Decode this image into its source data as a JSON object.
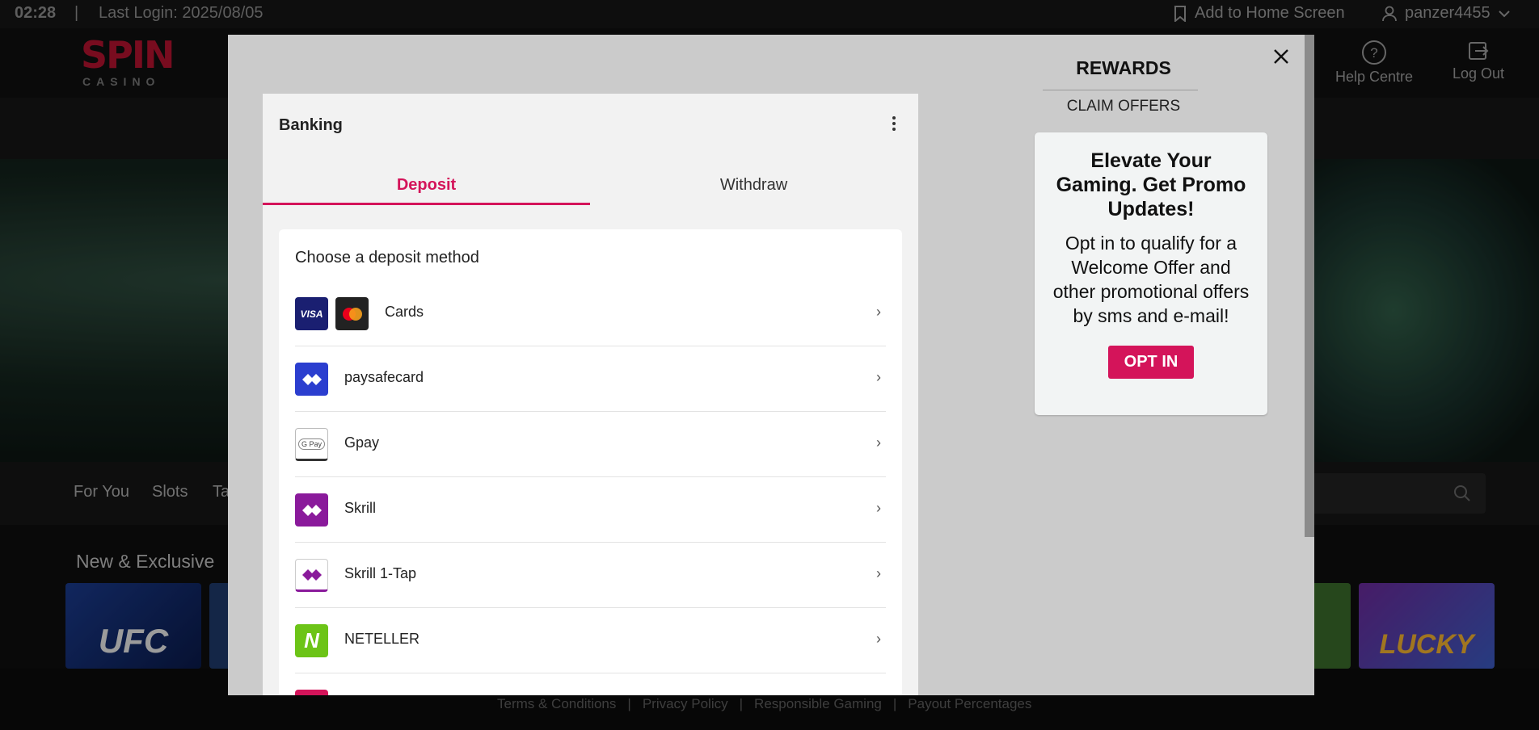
{
  "topbar": {
    "time": "02:28",
    "separator": "|",
    "last_login": "Last Login: 2025/08/05",
    "add_home": "Add to Home Screen",
    "username": "panzer4455"
  },
  "header": {
    "logo_spin": "SPIN",
    "logo_casino": "CASINO",
    "help": "Help Centre",
    "logout": "Log Out"
  },
  "categories": {
    "for_you": "For You",
    "slots": "Slots",
    "partial": "Ta"
  },
  "games": {
    "title": "New & Exclusive",
    "tile1": "UFC",
    "tile_last": "LUCKY"
  },
  "footer": {
    "terms": "Terms & Conditions",
    "privacy": "Privacy Policy",
    "responsible": "Responsible Gaming",
    "payout": "Payout Percentages",
    "pipe": "|"
  },
  "banking": {
    "title": "Banking",
    "tab_deposit": "Deposit",
    "tab_withdraw": "Withdraw",
    "heading": "Choose a deposit method",
    "methods": [
      {
        "name": "Cards"
      },
      {
        "name": "paysafecard"
      },
      {
        "name": "Gpay"
      },
      {
        "name": "Skrill"
      },
      {
        "name": "Skrill 1-Tap"
      },
      {
        "name": "NETELLER"
      }
    ],
    "chevron": "›",
    "visa": "VISA",
    "gpay": "G Pay",
    "neteller": "N"
  },
  "rewards": {
    "title": "REWARDS",
    "claim": "CLAIM OFFERS",
    "card_heading": "Elevate Your Gaming. Get Promo Updates!",
    "card_body": "Opt in to qualify for a Welcome Offer and other promotional offers by sms and e-mail!",
    "opt_in": "OPT IN"
  },
  "colors": {
    "accent": "#d4145a",
    "modal_bg": "#cbcbcb",
    "brand_red": "#b3122f"
  }
}
